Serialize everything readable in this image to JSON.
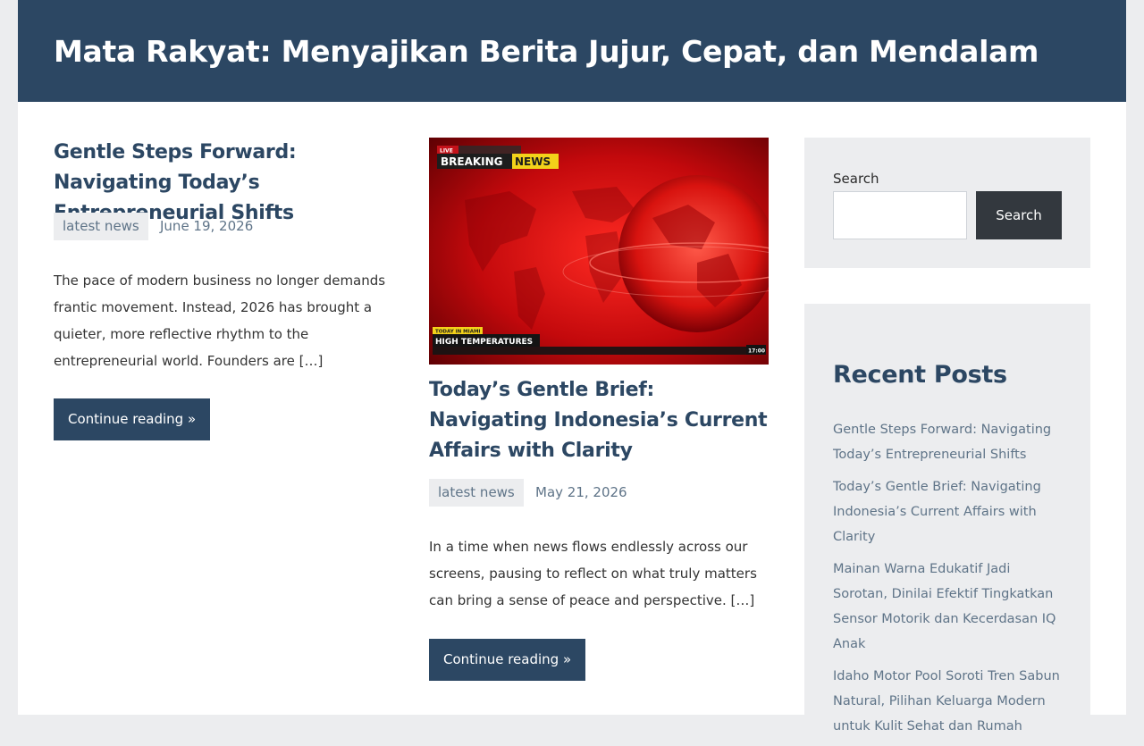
{
  "site": {
    "title": "Mata Rakyat: Menyajikan Berita Jujur, Cepat, dan Mendalam"
  },
  "posts": [
    {
      "title": "Gentle Steps Forward: Navigating Today’s Entrepreneurial Shifts",
      "category": "latest news",
      "date": "June 19, 2026",
      "excerpt": "The pace of modern business no longer demands frantic movement. Instead, 2026 has brought a quieter, more reflective rhythm to the entrepreneurial world. Founders are […]",
      "read_more": "Continue reading »"
    },
    {
      "title": "Today’s Gentle Brief: Navigating Indonesia’s Current Affairs with Clarity",
      "category": "latest news",
      "date": "May 21, 2026",
      "excerpt": "In a time when news flows endlessly across our screens, pausing to reflect on what truly matters can bring a sense of peace and perspective. […]",
      "read_more": "Continue reading »",
      "image": {
        "live_tag": "LIVE",
        "headline_a": "BREAKING",
        "headline_b": "NEWS",
        "today_tag": "TODAY IN MIAMI",
        "lower_third": "HIGH TEMPERATURES",
        "clock": "17:00"
      }
    }
  ],
  "sidebar": {
    "search": {
      "label": "Search",
      "placeholder": "",
      "button": "Search"
    },
    "recent": {
      "title": "Recent Posts",
      "items": [
        "Gentle Steps Forward: Navigating Today’s Entrepreneurial Shifts",
        "Today’s Gentle Brief: Navigating Indonesia’s Current Affairs with Clarity",
        "Mainan Warna Edukatif Jadi Sorotan, Dinilai Efektif Tingkatkan Sensor Motorik dan Kecerdasan IQ Anak",
        "Idaho Motor Pool Soroti Tren Sabun Natural, Pilihan Keluarga Modern untuk Kulit Sehat dan Rumah"
      ]
    }
  },
  "colors": {
    "header_bg": "#2c4763",
    "accent": "#2c4763",
    "meta_text": "#5f7488",
    "widget_bg": "#ecedef",
    "search_button": "#33383e",
    "breaking_red": "#c4121a",
    "breaking_yellow": "#f3d21a"
  }
}
